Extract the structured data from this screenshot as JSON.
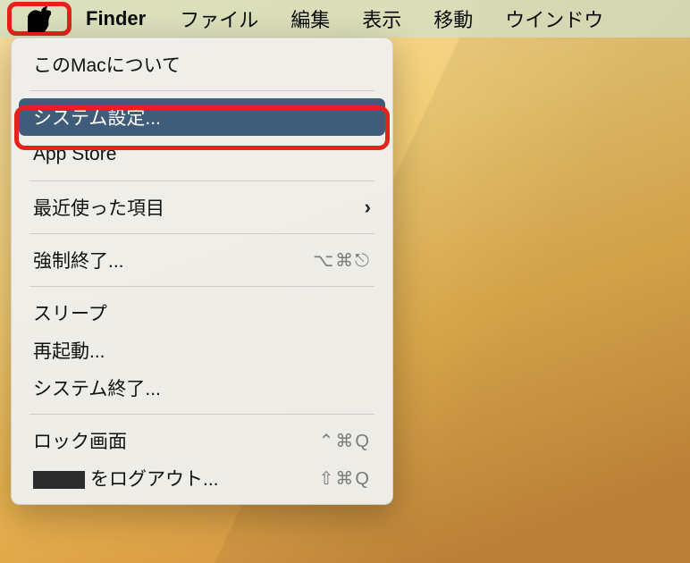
{
  "menubar": {
    "apple_icon": "apple-logo",
    "app_name": "Finder",
    "items": [
      "ファイル",
      "編集",
      "表示",
      "移動",
      "ウインドウ"
    ]
  },
  "apple_menu": {
    "about": "このMacについて",
    "system_settings": "システム設定...",
    "app_store": "App Store",
    "recent_items": "最近使った項目",
    "force_quit": "強制終了...",
    "force_quit_shortcut": "⌥⌘⎋",
    "sleep": "スリープ",
    "restart": "再起動...",
    "shutdown": "システム終了...",
    "lock_screen": "ロック画面",
    "lock_screen_shortcut": "⌃⌘Q",
    "logout_suffix": "をログアウト...",
    "logout_shortcut": "⇧⌘Q"
  },
  "highlight": {
    "color": "#e32219"
  }
}
